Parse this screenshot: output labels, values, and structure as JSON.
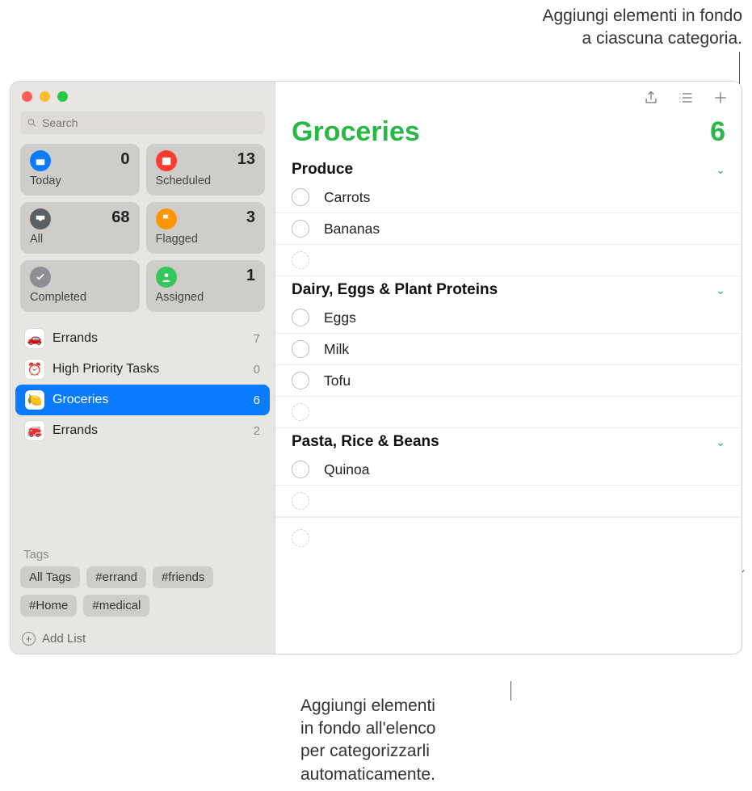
{
  "callouts": {
    "top": "Aggiungi elementi in fondo\na ciascuna categoria.",
    "bottom": "Aggiungi elementi\nin fondo all'elenco\nper categorizzarli\nautomaticamente."
  },
  "search": {
    "placeholder": "Search"
  },
  "smart": {
    "today": {
      "label": "Today",
      "count": "0"
    },
    "scheduled": {
      "label": "Scheduled",
      "count": "13"
    },
    "all": {
      "label": "All",
      "count": "68"
    },
    "flagged": {
      "label": "Flagged",
      "count": "3"
    },
    "completed": {
      "label": "Completed",
      "count": ""
    },
    "assigned": {
      "label": "Assigned",
      "count": "1"
    }
  },
  "lists": [
    {
      "emoji": "🚗",
      "name": "Errands",
      "count": "7",
      "selected": false
    },
    {
      "emoji": "⏰",
      "name": "High Priority Tasks",
      "count": "0",
      "selected": false
    },
    {
      "emoji": "🍋",
      "name": "Groceries",
      "count": "6",
      "selected": true
    },
    {
      "emoji": "🚒",
      "name": "Errands",
      "count": "2",
      "selected": false
    }
  ],
  "tags_header": "Tags",
  "tags": [
    "All Tags",
    "#errand",
    "#friends",
    "#Home",
    "#medical"
  ],
  "add_list": "Add List",
  "main": {
    "title": "Groceries",
    "count": "6",
    "sections": [
      {
        "title": "Produce",
        "items": [
          "Carrots",
          "Bananas"
        ]
      },
      {
        "title": "Dairy, Eggs & Plant Proteins",
        "items": [
          "Eggs",
          "Milk",
          "Tofu"
        ]
      },
      {
        "title": "Pasta, Rice & Beans",
        "items": [
          "Quinoa"
        ]
      }
    ]
  }
}
